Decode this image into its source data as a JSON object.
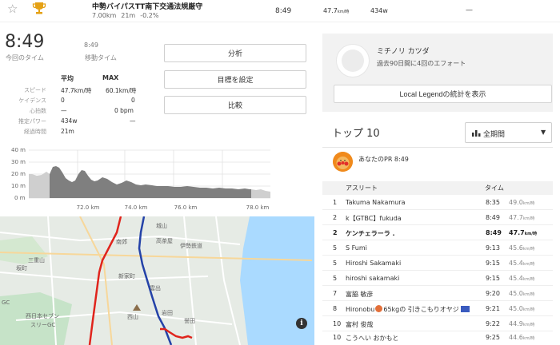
{
  "segment": {
    "name": "中勢バイパスTT南下交通法規厳守",
    "distance": "7.00km",
    "duration": "21m",
    "grade": "-0.2%",
    "time": "8:49",
    "speed_value": "47.7",
    "speed_unit": "km/時",
    "power": "434w",
    "extra": "—"
  },
  "summary": {
    "elapsed_time": "8:49",
    "elapsed_label": "今回のタイム",
    "moving_time": "8:49",
    "moving_label": "移動タイム"
  },
  "stats": {
    "col_avg": "平均",
    "col_max": "MAX",
    "rows": [
      {
        "label": "スピード",
        "avg": "47.7km/時",
        "max": "60.1km/時"
      },
      {
        "label": "ケイデンス",
        "avg": "0",
        "max": "0"
      },
      {
        "label": "心拍数",
        "avg": "—",
        "max": "0 bpm"
      },
      {
        "label": "推定パワー",
        "avg": "434w",
        "max": "—"
      },
      {
        "label": "経過時間",
        "avg": "21m",
        "max": ""
      }
    ]
  },
  "buttons": {
    "analyze": "分析",
    "set_goal": "目標を設定",
    "compare": "比較"
  },
  "elevation_chart": {
    "y_ticks": [
      "40 m",
      "30 m",
      "20 m",
      "10 m",
      "0 m"
    ],
    "x_ticks": [
      "72.0 km",
      "74.0 km",
      "76.0 km",
      "78.0 km"
    ]
  },
  "map": {
    "labels": [
      "城山",
      "高茶屋",
      "伊勢鉄道",
      "南郊",
      "新家町",
      "雲出",
      "西山",
      "誉田",
      "岩田",
      "三重山",
      "坂町",
      "西日本セブン",
      "スリーGC",
      "GC"
    ],
    "info": "i"
  },
  "local_legend": {
    "name": "ミチノリ カツダ",
    "description": "過去90日間に4回のエフォート",
    "button": "Local Legendの統計を表示"
  },
  "leaderboard": {
    "title": "トップ 10",
    "period": "全期間",
    "pr_label": "あなたのPR 8:49",
    "col_athlete": "アスリート",
    "col_time": "タイム",
    "speed_unit": "km/時",
    "rows": [
      {
        "rank": "1",
        "name": "Takuma Nakamura",
        "time": "8:35",
        "speed": "49.0"
      },
      {
        "rank": "2",
        "name": "k【GTBC】fukuda",
        "time": "8:49",
        "speed": "47.7"
      },
      {
        "rank": "2",
        "name": "ケンチェラーラ .",
        "time": "8:49",
        "speed": "47.7"
      },
      {
        "rank": "5",
        "name": "S Fumi",
        "time": "9:13",
        "speed": "45.6"
      },
      {
        "rank": "5",
        "name": "Hiroshi Sakamaki",
        "time": "9:15",
        "speed": "45.4"
      },
      {
        "rank": "5",
        "name": "hiroshi sakamaki",
        "time": "9:15",
        "speed": "45.4"
      },
      {
        "rank": "7",
        "name": "富脇 敏彦",
        "time": "9:20",
        "speed": "45.0"
      },
      {
        "rank": "8",
        "name": "Hironobu",
        "name_suffix": "65kgの 引きこもりオヤジ",
        "time": "9:21",
        "speed": "45.0"
      },
      {
        "rank": "10",
        "name": "富村 俊哉",
        "time": "9:22",
        "speed": "44.9"
      },
      {
        "rank": "10",
        "name": "こうへい おかもと",
        "time": "9:25",
        "speed": "44.6"
      }
    ]
  },
  "colors": {
    "route_red": "#e0241c",
    "route_blue": "#2442a8",
    "chart_fill": "#7f7f7f",
    "chart_highlight": "#cfcfcf",
    "avatar_orange": "#f08a1c"
  }
}
